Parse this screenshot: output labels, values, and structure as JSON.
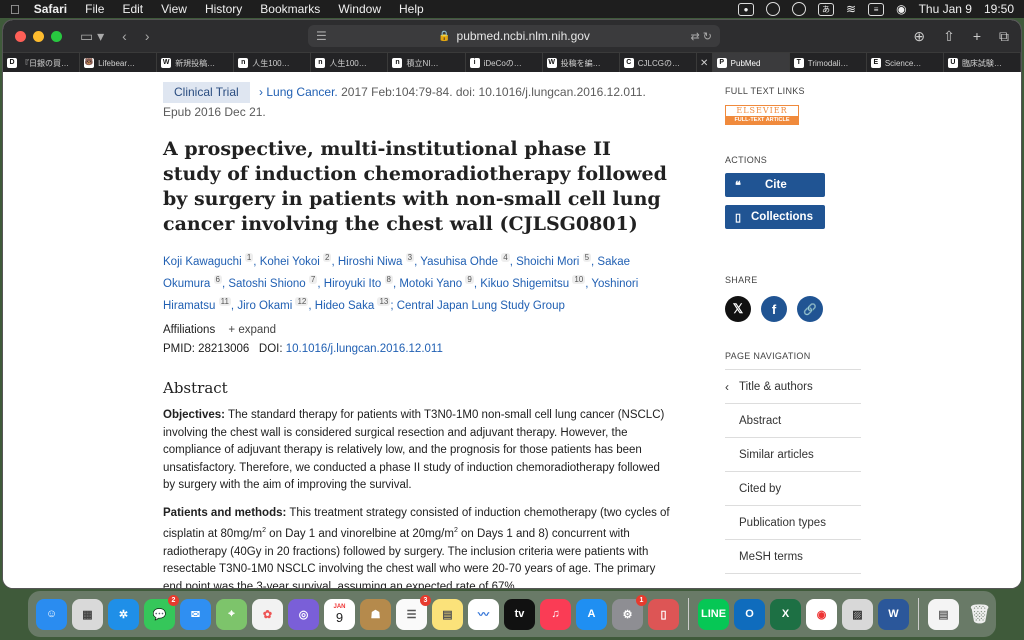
{
  "menubar": {
    "app": "Safari",
    "items": [
      "File",
      "Edit",
      "View",
      "History",
      "Bookmarks",
      "Window",
      "Help"
    ],
    "date": "Thu Jan 9",
    "time": "19:50",
    "input_method": "あ"
  },
  "browser": {
    "url": "pubmed.ncbi.nlm.nih.gov",
    "tabs": [
      {
        "icon": "D",
        "label": "『日銀の買…"
      },
      {
        "icon": "🐻",
        "label": "Lifebear…"
      },
      {
        "icon": "W",
        "label": "新規投稿…"
      },
      {
        "icon": "n",
        "label": "人生100…"
      },
      {
        "icon": "n",
        "label": "人生100…"
      },
      {
        "icon": "n",
        "label": "積立NI…"
      },
      {
        "icon": "i",
        "label": "iDeCoの…"
      },
      {
        "icon": "W",
        "label": "投稿を編…"
      },
      {
        "icon": "C",
        "label": "CJLCGの…"
      },
      {
        "icon": "P",
        "label": "PubMed"
      },
      {
        "icon": "T",
        "label": "Trimodali…"
      },
      {
        "icon": "E",
        "label": "Science…"
      },
      {
        "icon": "U",
        "label": "臨床試験…"
      }
    ]
  },
  "article": {
    "type_badge": "Clinical Trial",
    "journal": "Lung Cancer.",
    "citation": " 2017 Feb:104:79-84. doi: 10.1016/j.lungcan.2016.12.011.",
    "epub": "Epub 2016 Dec 21.",
    "title": "A prospective, multi-institutional phase II study of induction chemoradiotherapy followed by surgery in patients with non-small cell lung cancer involving the chest wall (CJLSG0801)",
    "authors": [
      {
        "name": "Koji Kawaguchi",
        "n": "1"
      },
      {
        "name": "Kohei Yokoi",
        "n": "2"
      },
      {
        "name": "Hiroshi Niwa",
        "n": "3"
      },
      {
        "name": "Yasuhisa Ohde",
        "n": "4"
      },
      {
        "name": "Shoichi Mori",
        "n": "5"
      },
      {
        "name": "Sakae Okumura",
        "n": "6"
      },
      {
        "name": "Satoshi Shiono",
        "n": "7"
      },
      {
        "name": "Hiroyuki Ito",
        "n": "8"
      },
      {
        "name": "Motoki Yano",
        "n": "9"
      },
      {
        "name": "Kikuo Shigemitsu",
        "n": "10"
      },
      {
        "name": "Yoshinori Hiramatsu",
        "n": "11"
      },
      {
        "name": "Jiro Okami",
        "n": "12"
      },
      {
        "name": "Hideo Saka",
        "n": "13"
      }
    ],
    "group": "Central Japan Lung Study Group",
    "affiliations_label": "Affiliations",
    "expand_label": "expand",
    "pmid_label": "PMID: ",
    "pmid": "28213006",
    "doi_label": "DOI: ",
    "doi": "10.1016/j.lungcan.2016.12.011",
    "abstract_heading": "Abstract",
    "objectives_label": "Objectives:",
    "objectives": " The standard therapy for patients with T3N0-1M0 non-small cell lung cancer (NSCLC) involving the chest wall is considered surgical resection and adjuvant therapy. However, the compliance of adjuvant therapy is relatively low, and the prognosis for those patients has been unsatisfactory. Therefore, we conducted a phase II study of induction chemoradiotherapy followed by surgery with the aim of improving the survival.",
    "methods_label": "Patients and methods:",
    "methods_1": " This treatment strategy consisted of induction chemotherapy (two cycles of cisplatin at 80mg/m",
    "methods_2": " on Day 1 and vinorelbine at 20mg/m",
    "methods_3": " on Days 1 and 8) concurrent with radiotherapy (40Gy in 20 fractions) followed by surgery. The inclusion criteria were patients with resectable T3N0-1M0 NSCLC involving the chest wall who were 20-70 years of age. The primary end point was the 3-year survival, assuming an expected rate of 67%.",
    "sup2": "2"
  },
  "sidebar": {
    "full_text_heading": "FULL TEXT LINKS",
    "publisher_top": "ELSEVIER",
    "publisher_bottom": "FULL-TEXT ARTICLE",
    "actions_heading": "ACTIONS",
    "cite_label": "Cite",
    "collections_label": "Collections",
    "share_heading": "SHARE",
    "nav_heading": "PAGE NAVIGATION",
    "nav_items": [
      "Title & authors",
      "Abstract",
      "Similar articles",
      "Cited by",
      "Publication types",
      "MeSH terms"
    ]
  },
  "dock": {
    "badges": {
      "messages": "2",
      "reminders": "3",
      "settings": "1"
    },
    "calendar_month": "JAN",
    "calendar_day": "9"
  },
  "colors": {
    "link": "#2160b3",
    "button": "#205493",
    "badge_bg": "#dfe6f1"
  }
}
